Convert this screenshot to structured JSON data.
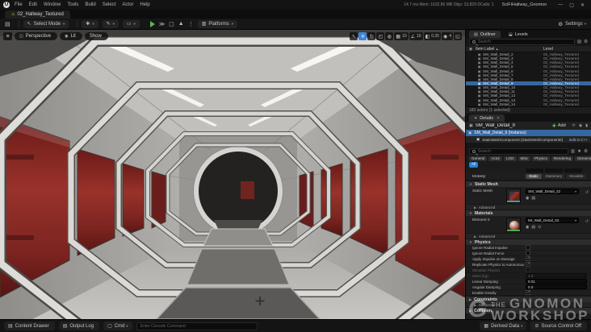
{
  "icons": {
    "logo": "U",
    "save": "▤",
    "caret": "▾",
    "cursor": "↖",
    "add": "✚",
    "blueprint": "✎",
    "cinematics": "▭",
    "skip": "≫",
    "stop": "▢",
    "eject": "▲",
    "more": "⋮",
    "platforms": "▥",
    "gear": "⚙",
    "folder": "▧",
    "eye": "◉",
    "close": "✕",
    "minimize": "—",
    "maximize": "▢",
    "warning": "⚠",
    "hamburger": "≡",
    "grid": "▦",
    "angle": "∠",
    "scalesnap": "◧",
    "camspeed": "◉",
    "maxvp": "◱",
    "select": "↖",
    "move": "✛",
    "rotate": "↻",
    "scale": "◰",
    "globe": "◍",
    "star": "★",
    "panel": "▥",
    "reset": "↺",
    "copy": "▤",
    "browse": "◉",
    "pipette": "⊙",
    "cube": "▣",
    "cycle": "⟳",
    "lock": "▮",
    "levels": "⬓",
    "outliner": "▤",
    "details": "✦",
    "sort": "▲",
    "nocontrol": "⊘",
    "drawer": "▤",
    "log": "▤",
    "cmd": "▢",
    "derived": "▦"
  },
  "titlebar": {
    "menus": [
      "File",
      "Edit",
      "Window",
      "Tools",
      "Build",
      "Select",
      "Actor",
      "Help"
    ],
    "stats": "14.7 ms   Mem: 1632.86 MB   Objs: 33,829   DCalls: 1",
    "session": "SciFiHallway_Gnomon",
    "tab": "02_Hallway_Textured"
  },
  "toolbar": {
    "select_mode": "Select Mode",
    "platforms": "Platforms",
    "settings": "Settings"
  },
  "viewport": {
    "perspective": "Perspective",
    "lit": "Lit",
    "show": "Show",
    "tools": [
      {
        "name": "select-tool",
        "icon": "select"
      },
      {
        "name": "move-tool",
        "icon": "move",
        "active": true
      },
      {
        "name": "rotate-tool",
        "icon": "rotate"
      },
      {
        "name": "scale-tool",
        "icon": "scale"
      },
      {
        "name": "world-space-toggle",
        "icon": "globe"
      },
      {
        "name": "grid-snap-toggle",
        "icon": "grid",
        "value": "10"
      },
      {
        "name": "rotation-snap-toggle",
        "icon": "angle",
        "value": "10"
      },
      {
        "name": "scale-snap-toggle",
        "icon": "scalesnap",
        "value": "0.25"
      },
      {
        "name": "camera-speed",
        "icon": "camspeed",
        "value": "4"
      },
      {
        "name": "maximize-viewport",
        "icon": "maxvp"
      }
    ]
  },
  "outliner": {
    "tab_outliner": "Outliner",
    "tab_levels": "Levels",
    "search_placeholder": "Search",
    "col_item": "Item Label",
    "col_level": "Level",
    "rows": [
      {
        "name": "SM_Wall_Detail_2",
        "level": "02_Hallway_Textured"
      },
      {
        "name": "SM_Wall_Detail_3",
        "level": "02_Hallway_Textured"
      },
      {
        "name": "SM_Wall_Detail_4",
        "level": "02_Hallway_Textured"
      },
      {
        "name": "SM_Wall_Detail_5",
        "level": "02_Hallway_Textured"
      },
      {
        "name": "SM_Wall_Detail_6",
        "level": "02_Hallway_Textured"
      },
      {
        "name": "SM_Wall_Detail_7",
        "level": "02_Hallway_Textured"
      },
      {
        "name": "SM_Wall_Detail_8",
        "level": "02_Hallway_Textured"
      },
      {
        "name": "SM_Wall_Detail_9",
        "level": "02_Hallway_Textured",
        "selected": true
      },
      {
        "name": "SM_Wall_Detail_10",
        "level": "02_Hallway_Textured"
      },
      {
        "name": "SM_Wall_Detail_11",
        "level": "02_Hallway_Textured"
      },
      {
        "name": "SM_Wall_Detail_12",
        "level": "02_Hallway_Textured"
      },
      {
        "name": "SM_Wall_Detail_13",
        "level": "02_Hallway_Textured"
      },
      {
        "name": "SM_Wall_Detail_14",
        "level": "02_Hallway_Textured"
      }
    ],
    "footer": "183 actors (1 selected)"
  },
  "details": {
    "tab": "Details",
    "actor_name": "SM_Wall_Detail_9",
    "add_label": "Add",
    "tree_instance": "SM_Wall_Detail_9 (Instance)",
    "tree_component": "StaticMeshComponent (StaticMeshComponent0)",
    "edit_cpp": "Edit in C++",
    "search_placeholder": "Search",
    "categories": [
      "General",
      "Actor",
      "LOD",
      "Misc",
      "Physics",
      "Rendering",
      "Streaming"
    ],
    "all_label": "All",
    "mobility": {
      "label": "Mobility",
      "options": [
        "Static",
        "Stationary",
        "Movable"
      ],
      "selected": "Static"
    },
    "static_mesh_section": "Static Mesh",
    "static_mesh_label": "Static Mesh",
    "static_mesh_value": "SM_Wall_Detail_22",
    "advanced_label": "Advanced",
    "materials_section": "Materials",
    "element_label": "Element 0",
    "material_value": "MI_Wall_Detail_02",
    "physics_section": "Physics",
    "physics_rows": [
      {
        "label": "Ignore Radial Impulse",
        "type": "check",
        "checked": false
      },
      {
        "label": "Ignore Radial Force",
        "type": "check",
        "checked": false
      },
      {
        "label": "Apply Impulse on Damage",
        "type": "check",
        "checked": true
      },
      {
        "label": "Replicate Physics to Autonomous Proxy",
        "type": "check",
        "checked": true
      },
      {
        "label": "Simulate Physics",
        "type": "check",
        "checked": false,
        "dim": true
      },
      {
        "label": "Mass (kg)",
        "type": "value",
        "value": "1.0",
        "dim": true,
        "override": true
      },
      {
        "label": "Linear Damping",
        "type": "value",
        "value": "0.01"
      },
      {
        "label": "Angular Damping",
        "type": "value",
        "value": "0.0"
      },
      {
        "label": "Enable Gravity",
        "type": "check",
        "checked": true
      }
    ],
    "collapsed_sections": [
      {
        "label": "Constraints",
        "style": "section"
      },
      {
        "label": "Advanced",
        "style": "sub"
      },
      {
        "label": "Collision",
        "style": "section"
      }
    ]
  },
  "statusbar": {
    "content_drawer": "Content Drawer",
    "output_log": "Output Log",
    "cmd": "Cmd",
    "console_placeholder": "Enter Console Command",
    "derived_data": "Derived Data",
    "source_control": "Source Control Off"
  },
  "watermark": {
    "the": "THE",
    "line1": "GNOMON",
    "line2": "WORKSHOP"
  }
}
